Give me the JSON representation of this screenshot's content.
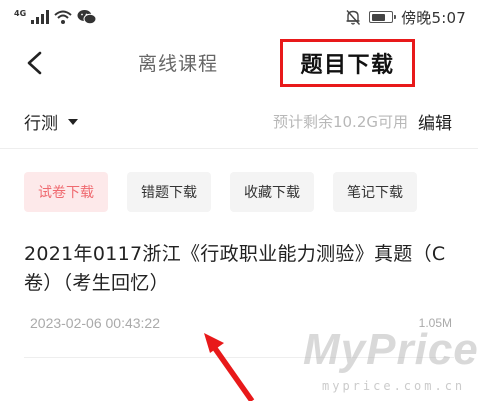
{
  "status_bar": {
    "network": "4G",
    "signal_icon": "signal-bars-icon",
    "wifi_icon": "wifi-icon",
    "wechat_icon": "wechat-icon",
    "mute_icon": "bell-off-icon",
    "battery_level": 0.7,
    "time": "傍晚5:07"
  },
  "nav": {
    "back_icon": "chevron-left-icon",
    "tab_offline_courses": "离线课程",
    "tab_question_download": "题目下载",
    "highlight_color": "#e8191a"
  },
  "subject_bar": {
    "subject": "行测",
    "storage": "预计剩余10.2G可用",
    "edit": "编辑"
  },
  "filters": [
    {
      "label": "试卷下载",
      "active": true
    },
    {
      "label": "错题下载",
      "active": false
    },
    {
      "label": "收藏下载",
      "active": false
    },
    {
      "label": "笔记下载",
      "active": false
    }
  ],
  "downloads": [
    {
      "title": "2021年0117浙江《行政职业能力测验》真题（C卷）（考生回忆）",
      "date": "2023-02-06 00:43:22",
      "size": "1.05M"
    }
  ],
  "watermark": {
    "brand": "MyPrice",
    "domain": "myprice.com.cn"
  },
  "colors": {
    "accent": "#e8191a",
    "active_chip_bg": "#fde9ea",
    "active_chip_text": "#ef6a70",
    "muted_text": "#aaaaaa"
  }
}
